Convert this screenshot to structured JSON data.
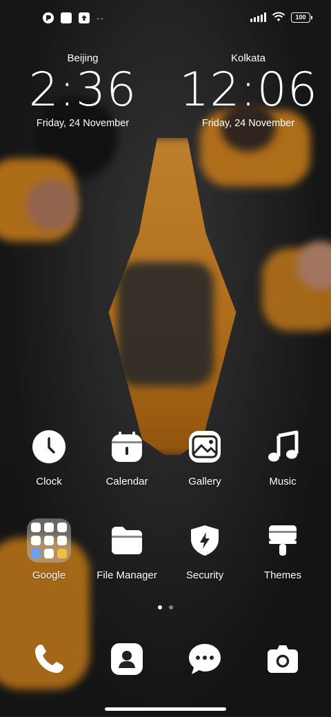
{
  "statusbar": {
    "left_icons": [
      "notification-a-icon",
      "notification-square-icon",
      "notification-upload-icon",
      "more-dots-icon"
    ],
    "battery": "100"
  },
  "clocks": [
    {
      "city": "Beijing",
      "time": "2:36",
      "date": "Friday, 24 November"
    },
    {
      "city": "Kolkata",
      "time": "12:06",
      "date": "Friday, 24 November"
    }
  ],
  "apps": [
    {
      "label": "Clock",
      "icon": "clock-icon"
    },
    {
      "label": "Calendar",
      "icon": "calendar-icon"
    },
    {
      "label": "Gallery",
      "icon": "gallery-icon"
    },
    {
      "label": "Music",
      "icon": "music-note-icon"
    },
    {
      "label": "Google",
      "icon": "google-folder-icon"
    },
    {
      "label": "File Manager",
      "icon": "folder-icon"
    },
    {
      "label": "Security",
      "icon": "shield-bolt-icon"
    },
    {
      "label": "Themes",
      "icon": "paint-brush-icon"
    }
  ],
  "dock": [
    {
      "name": "phone",
      "icon": "phone-icon"
    },
    {
      "name": "contacts",
      "icon": "contacts-icon"
    },
    {
      "name": "messages",
      "icon": "message-icon"
    },
    {
      "name": "camera",
      "icon": "camera-icon"
    }
  ],
  "pager": {
    "pages": 2,
    "active": 1
  },
  "colors": {
    "accent_orange": "#e8901f",
    "icon_white": "#ffffff"
  }
}
